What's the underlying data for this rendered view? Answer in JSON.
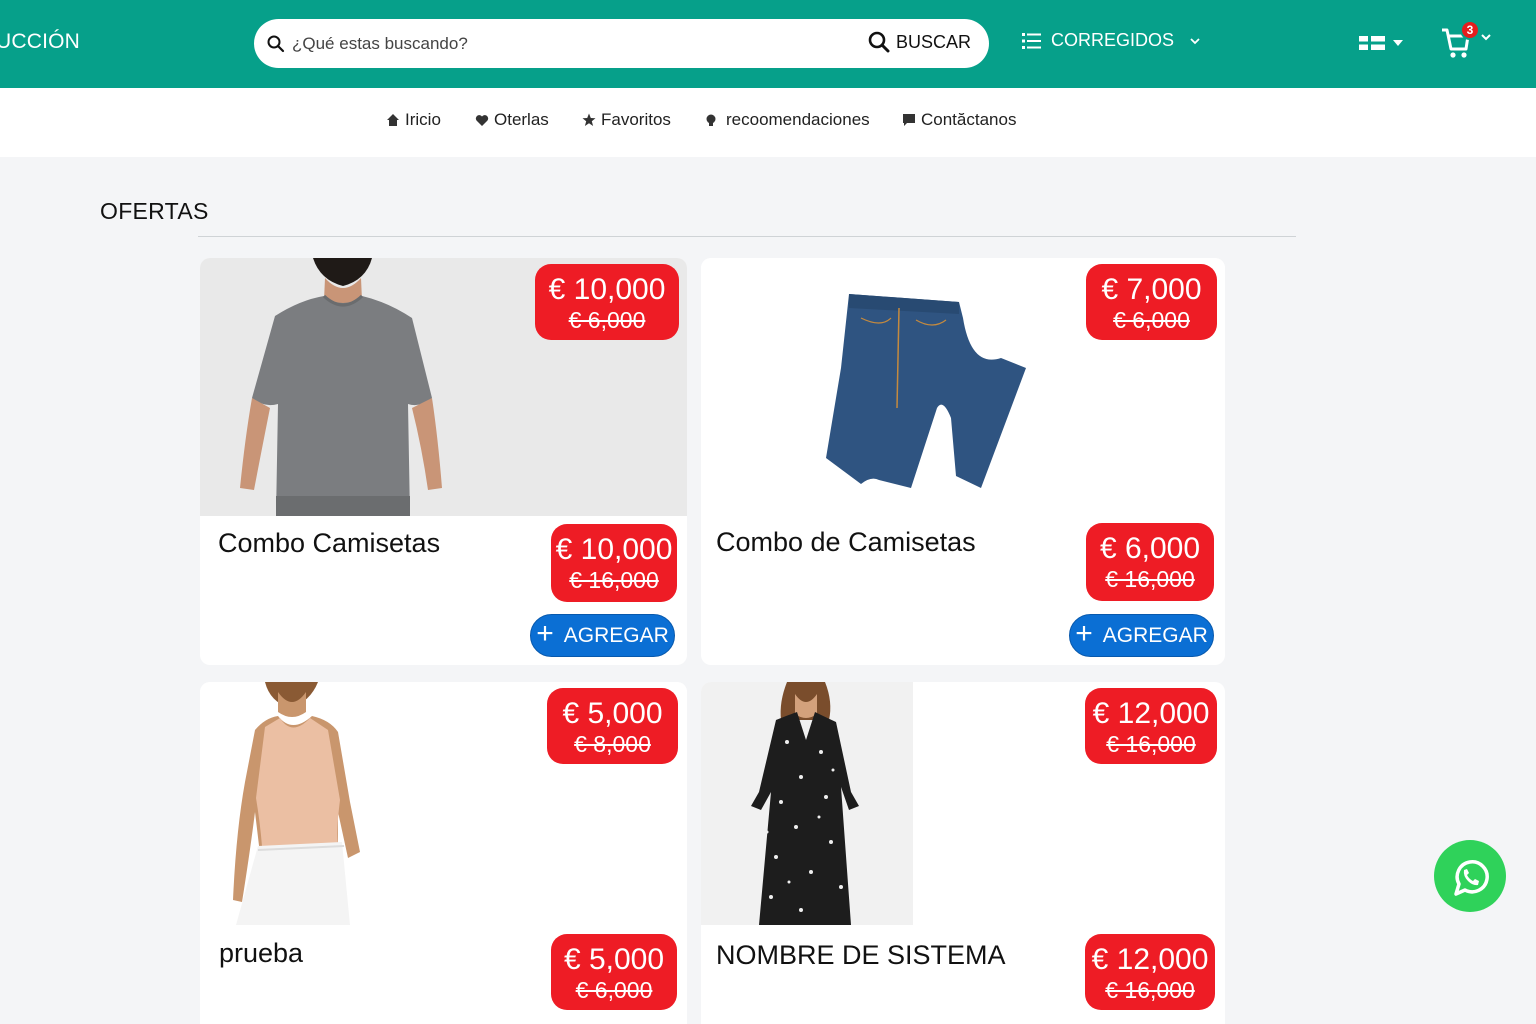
{
  "header": {
    "brand": "UCCIÓN",
    "search": {
      "placeholder": "¿Qué estas buscando?",
      "button_label": "BUSCAR"
    },
    "category_menu": {
      "label": "CORREGIDOS"
    },
    "cart": {
      "count": "3"
    },
    "colors": {
      "bar": "#06a08a",
      "badge": "#e51d1d"
    }
  },
  "nav": {
    "items": [
      {
        "label": "Iricio",
        "icon": "home-icon"
      },
      {
        "label": "Oterlas",
        "icon": "heart-icon"
      },
      {
        "label": "Favoritos",
        "icon": "star-icon"
      },
      {
        "label": "recoomendaciones",
        "icon": "bulb-icon"
      },
      {
        "label": "Contăctanos",
        "icon": "chat-icon"
      }
    ]
  },
  "section": {
    "title": "OFERTAS"
  },
  "products": [
    {
      "name": "Combo Camisetas",
      "badge_price": "€ 10,000",
      "badge_old": "€ 6,000",
      "price": "€ 10,000",
      "old_price": "€ 16,000",
      "add_label": "AGREGAR",
      "image": "gray-tshirt"
    },
    {
      "name": "Combo de Camisetas",
      "badge_price": "€ 7,000",
      "badge_old": "€ 6,000",
      "price": "€ 6,000",
      "old_price": "€ 16,000",
      "add_label": "AGREGAR",
      "image": "jeans"
    },
    {
      "name": "prueba",
      "badge_price": "€ 5,000",
      "badge_old": "€ 8,000",
      "price": "€ 5,000",
      "old_price": "€ 6,000",
      "add_label": "AGREGAR",
      "image": "tank-top"
    },
    {
      "name": "NOMBRE DE SISTEMA",
      "badge_price": "€ 12,000",
      "badge_old": "€ 16,000",
      "price": "€ 12,000",
      "old_price": "€ 16,000",
      "add_label": "AGREGAR",
      "image": "floral-dress"
    }
  ],
  "accent": {
    "price_red": "#ee1c25",
    "button_blue": "#0b6fd4",
    "whatsapp_green": "#2fd25a"
  }
}
